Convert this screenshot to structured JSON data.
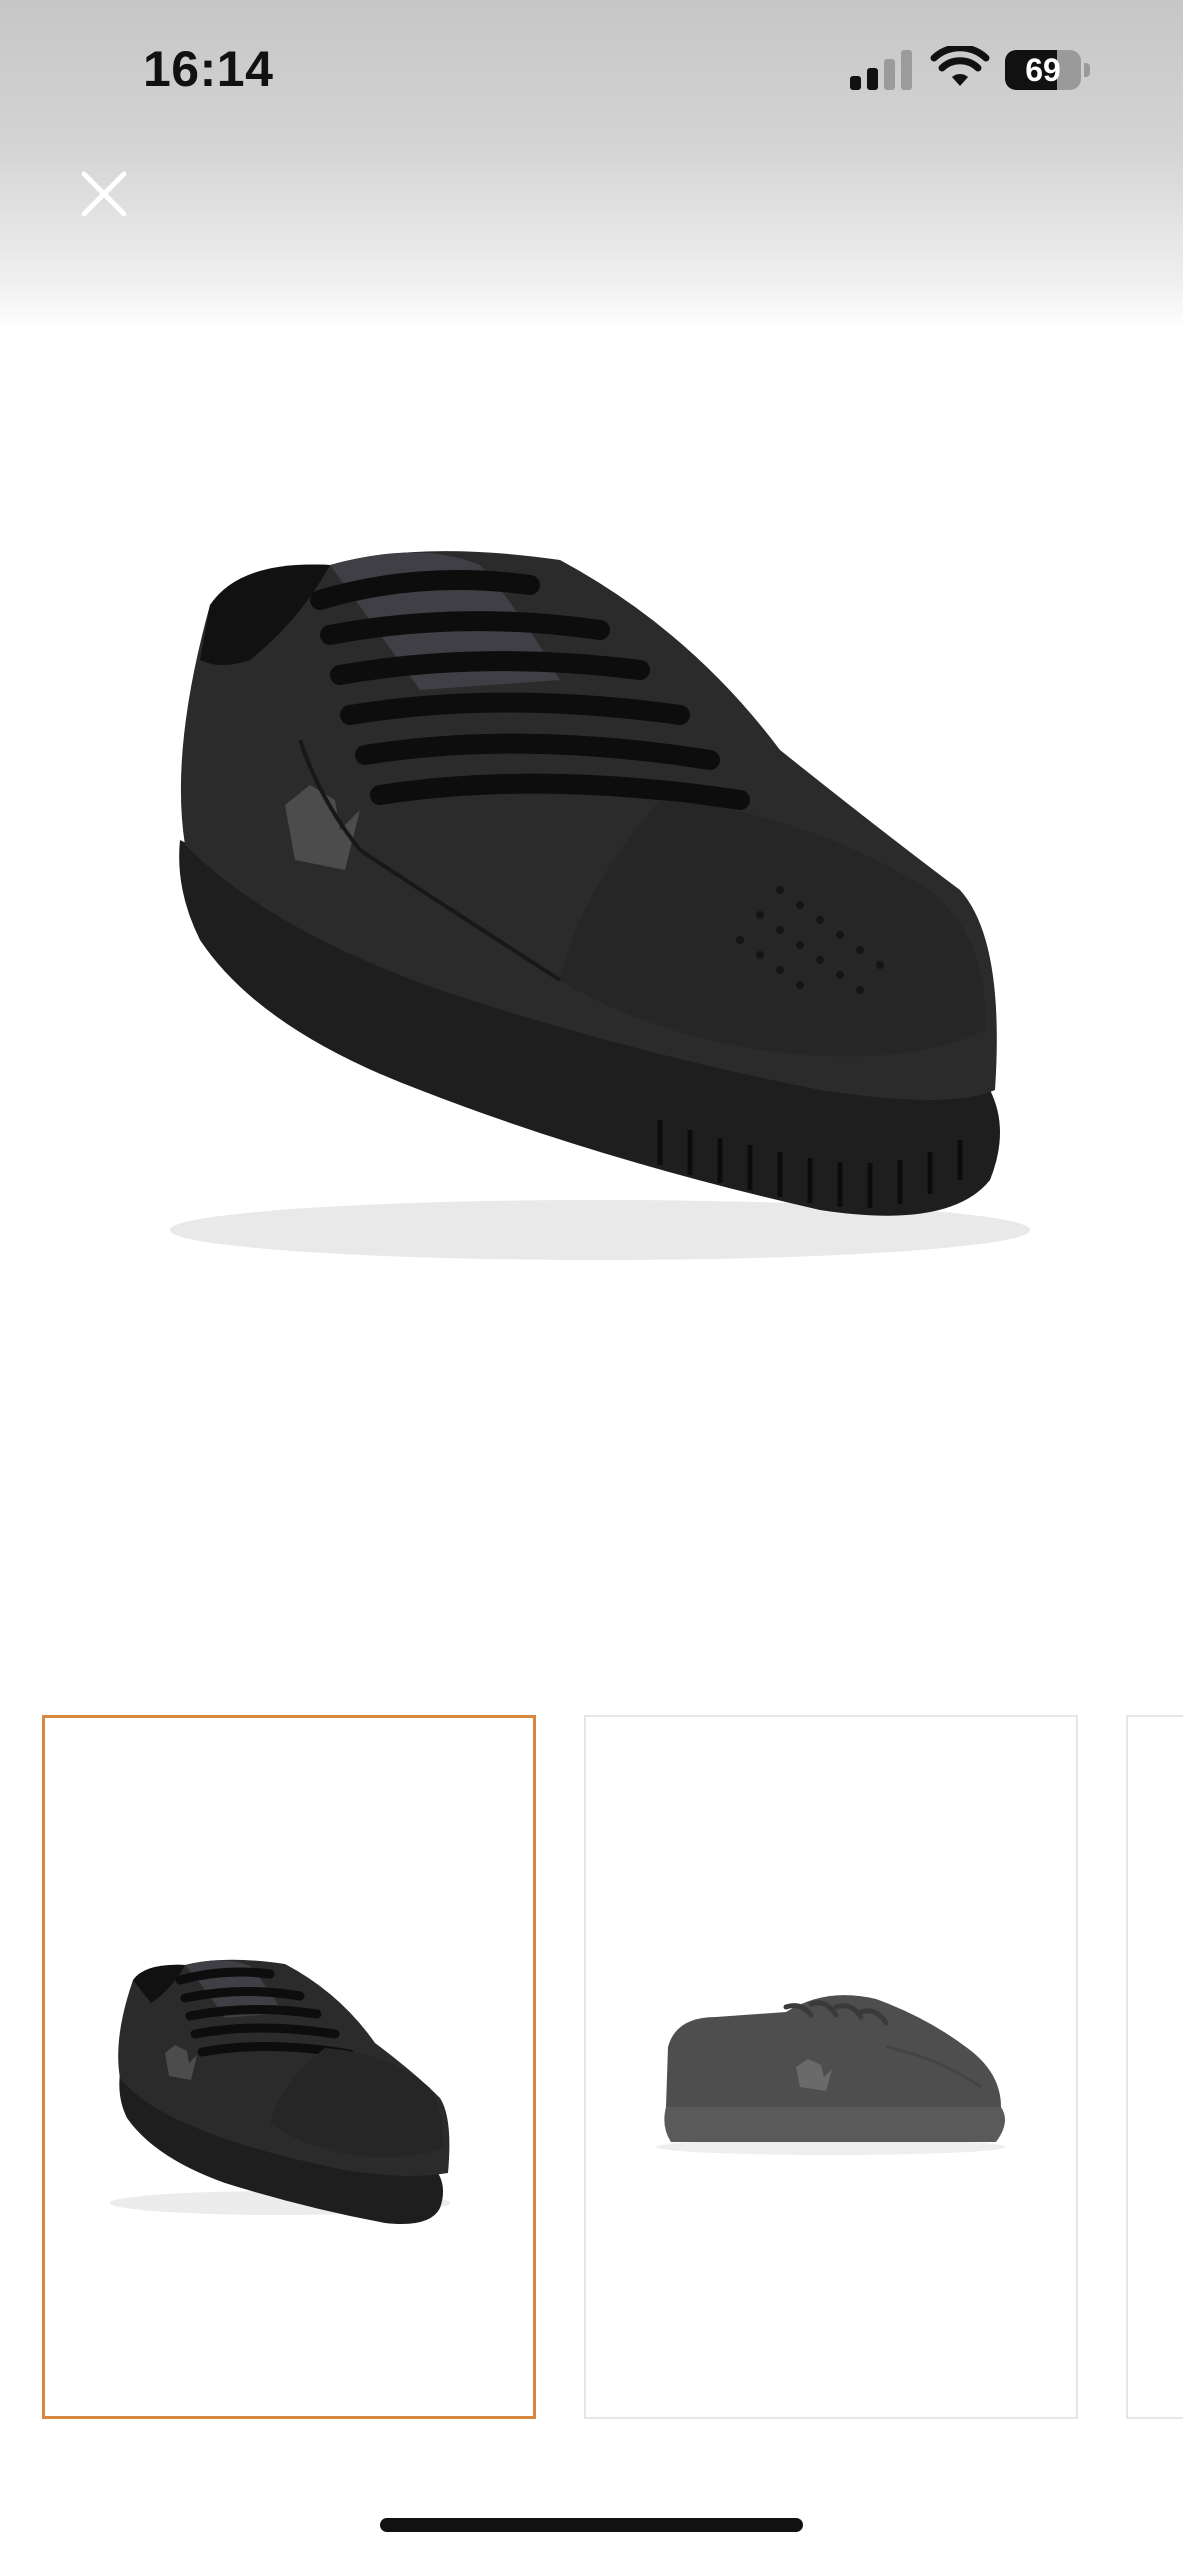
{
  "status_bar": {
    "time": "16:14",
    "battery_level": "69",
    "battery_fraction": 0.69,
    "signal_bars_active": 2,
    "signal_bars_total": 4,
    "icons": [
      "cellular-signal-icon",
      "wifi-icon",
      "battery-icon"
    ]
  },
  "header": {
    "close_icon": "close-icon"
  },
  "gallery": {
    "main_image": "black-sneaker-front-view",
    "selected_index": 0,
    "thumbnails": [
      {
        "image": "black-sneaker-front-view",
        "selected": true
      },
      {
        "image": "black-sneaker-side-view",
        "selected": false
      },
      {
        "image": "sneaker-partial-view",
        "selected": false
      }
    ],
    "selected_border_color": "#d9863e"
  }
}
